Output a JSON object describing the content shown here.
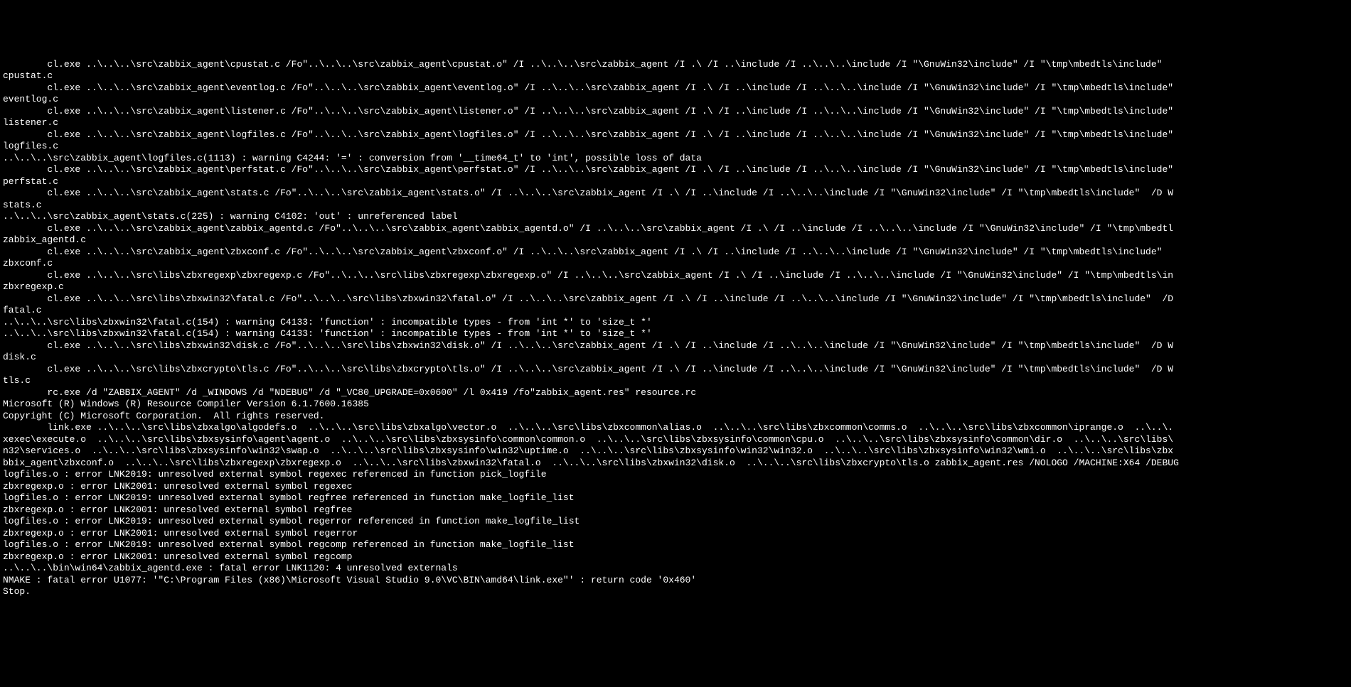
{
  "terminal": {
    "lines": [
      "        cl.exe ..\\..\\..\\src\\zabbix_agent\\cpustat.c /Fo\"..\\..\\..\\src\\zabbix_agent\\cpustat.o\" /I ..\\..\\..\\src\\zabbix_agent /I .\\ /I ..\\include /I ..\\..\\..\\include /I \"\\GnuWin32\\include\" /I \"\\tmp\\mbedtls\\include\"",
      "cpustat.c",
      "        cl.exe ..\\..\\..\\src\\zabbix_agent\\eventlog.c /Fo\"..\\..\\..\\src\\zabbix_agent\\eventlog.o\" /I ..\\..\\..\\src\\zabbix_agent /I .\\ /I ..\\include /I ..\\..\\..\\include /I \"\\GnuWin32\\include\" /I \"\\tmp\\mbedtls\\include\"",
      "eventlog.c",
      "        cl.exe ..\\..\\..\\src\\zabbix_agent\\listener.c /Fo\"..\\..\\..\\src\\zabbix_agent\\listener.o\" /I ..\\..\\..\\src\\zabbix_agent /I .\\ /I ..\\include /I ..\\..\\..\\include /I \"\\GnuWin32\\include\" /I \"\\tmp\\mbedtls\\include\"",
      "listener.c",
      "        cl.exe ..\\..\\..\\src\\zabbix_agent\\logfiles.c /Fo\"..\\..\\..\\src\\zabbix_agent\\logfiles.o\" /I ..\\..\\..\\src\\zabbix_agent /I .\\ /I ..\\include /I ..\\..\\..\\include /I \"\\GnuWin32\\include\" /I \"\\tmp\\mbedtls\\include\"",
      "logfiles.c",
      "..\\..\\..\\src\\zabbix_agent\\logfiles.c(1113) : warning C4244: '=' : conversion from '__time64_t' to 'int', possible loss of data",
      "        cl.exe ..\\..\\..\\src\\zabbix_agent\\perfstat.c /Fo\"..\\..\\..\\src\\zabbix_agent\\perfstat.o\" /I ..\\..\\..\\src\\zabbix_agent /I .\\ /I ..\\include /I ..\\..\\..\\include /I \"\\GnuWin32\\include\" /I \"\\tmp\\mbedtls\\include\"",
      "perfstat.c",
      "        cl.exe ..\\..\\..\\src\\zabbix_agent\\stats.c /Fo\"..\\..\\..\\src\\zabbix_agent\\stats.o\" /I ..\\..\\..\\src\\zabbix_agent /I .\\ /I ..\\include /I ..\\..\\..\\include /I \"\\GnuWin32\\include\" /I \"\\tmp\\mbedtls\\include\"  /D W",
      "stats.c",
      "..\\..\\..\\src\\zabbix_agent\\stats.c(225) : warning C4102: 'out' : unreferenced label",
      "        cl.exe ..\\..\\..\\src\\zabbix_agent\\zabbix_agentd.c /Fo\"..\\..\\..\\src\\zabbix_agent\\zabbix_agentd.o\" /I ..\\..\\..\\src\\zabbix_agent /I .\\ /I ..\\include /I ..\\..\\..\\include /I \"\\GnuWin32\\include\" /I \"\\tmp\\mbedtl",
      "zabbix_agentd.c",
      "        cl.exe ..\\..\\..\\src\\zabbix_agent\\zbxconf.c /Fo\"..\\..\\..\\src\\zabbix_agent\\zbxconf.o\" /I ..\\..\\..\\src\\zabbix_agent /I .\\ /I ..\\include /I ..\\..\\..\\include /I \"\\GnuWin32\\include\" /I \"\\tmp\\mbedtls\\include\"",
      "zbxconf.c",
      "        cl.exe ..\\..\\..\\src\\libs\\zbxregexp\\zbxregexp.c /Fo\"..\\..\\..\\src\\libs\\zbxregexp\\zbxregexp.o\" /I ..\\..\\..\\src\\zabbix_agent /I .\\ /I ..\\include /I ..\\..\\..\\include /I \"\\GnuWin32\\include\" /I \"\\tmp\\mbedtls\\in",
      "zbxregexp.c",
      "        cl.exe ..\\..\\..\\src\\libs\\zbxwin32\\fatal.c /Fo\"..\\..\\..\\src\\libs\\zbxwin32\\fatal.o\" /I ..\\..\\..\\src\\zabbix_agent /I .\\ /I ..\\include /I ..\\..\\..\\include /I \"\\GnuWin32\\include\" /I \"\\tmp\\mbedtls\\include\"  /D",
      "fatal.c",
      "..\\..\\..\\src\\libs\\zbxwin32\\fatal.c(154) : warning C4133: 'function' : incompatible types - from 'int *' to 'size_t *'",
      "..\\..\\..\\src\\libs\\zbxwin32\\fatal.c(154) : warning C4133: 'function' : incompatible types - from 'int *' to 'size_t *'",
      "        cl.exe ..\\..\\..\\src\\libs\\zbxwin32\\disk.c /Fo\"..\\..\\..\\src\\libs\\zbxwin32\\disk.o\" /I ..\\..\\..\\src\\zabbix_agent /I .\\ /I ..\\include /I ..\\..\\..\\include /I \"\\GnuWin32\\include\" /I \"\\tmp\\mbedtls\\include\"  /D W",
      "disk.c",
      "        cl.exe ..\\..\\..\\src\\libs\\zbxcrypto\\tls.c /Fo\"..\\..\\..\\src\\libs\\zbxcrypto\\tls.o\" /I ..\\..\\..\\src\\zabbix_agent /I .\\ /I ..\\include /I ..\\..\\..\\include /I \"\\GnuWin32\\include\" /I \"\\tmp\\mbedtls\\include\"  /D W",
      "tls.c",
      "        rc.exe /d \"ZABBIX_AGENT\" /d _WINDOWS /d \"NDEBUG\" /d \"_VC80_UPGRADE=0x0600\" /l 0x419 /fo\"zabbix_agent.res\" resource.rc",
      "Microsoft (R) Windows (R) Resource Compiler Version 6.1.7600.16385",
      "Copyright (C) Microsoft Corporation.  All rights reserved.",
      "",
      "",
      "        link.exe ..\\..\\..\\src\\libs\\zbxalgo\\algodefs.o  ..\\..\\..\\src\\libs\\zbxalgo\\vector.o  ..\\..\\..\\src\\libs\\zbxcommon\\alias.o  ..\\..\\..\\src\\libs\\zbxcommon\\comms.o  ..\\..\\..\\src\\libs\\zbxcommon\\iprange.o  ..\\..\\.",
      "xexec\\execute.o  ..\\..\\..\\src\\libs\\zbxsysinfo\\agent\\agent.o  ..\\..\\..\\src\\libs\\zbxsysinfo\\common\\common.o  ..\\..\\..\\src\\libs\\zbxsysinfo\\common\\cpu.o  ..\\..\\..\\src\\libs\\zbxsysinfo\\common\\dir.o  ..\\..\\..\\src\\libs\\",
      "n32\\services.o  ..\\..\\..\\src\\libs\\zbxsysinfo\\win32\\swap.o  ..\\..\\..\\src\\libs\\zbxsysinfo\\win32\\uptime.o  ..\\..\\..\\src\\libs\\zbxsysinfo\\win32\\win32.o  ..\\..\\..\\src\\libs\\zbxsysinfo\\win32\\wmi.o  ..\\..\\..\\src\\libs\\zbx",
      "bbix_agent\\zbxconf.o  ..\\..\\..\\src\\libs\\zbxregexp\\zbxregexp.o  ..\\..\\..\\src\\libs\\zbxwin32\\fatal.o  ..\\..\\..\\src\\libs\\zbxwin32\\disk.o  ..\\..\\..\\src\\libs\\zbxcrypto\\tls.o zabbix_agent.res /NOLOGO /MACHINE:X64 /DEBUG",
      "logfiles.o : error LNK2019: unresolved external symbol regexec referenced in function pick_logfile",
      "zbxregexp.o : error LNK2001: unresolved external symbol regexec",
      "logfiles.o : error LNK2019: unresolved external symbol regfree referenced in function make_logfile_list",
      "zbxregexp.o : error LNK2001: unresolved external symbol regfree",
      "logfiles.o : error LNK2019: unresolved external symbol regerror referenced in function make_logfile_list",
      "zbxregexp.o : error LNK2001: unresolved external symbol regerror",
      "logfiles.o : error LNK2019: unresolved external symbol regcomp referenced in function make_logfile_list",
      "zbxregexp.o : error LNK2001: unresolved external symbol regcomp",
      "..\\..\\..\\bin\\win64\\zabbix_agentd.exe : fatal error LNK1120: 4 unresolved externals",
      "NMAKE : fatal error U1077: '\"C:\\Program Files (x86)\\Microsoft Visual Studio 9.0\\VC\\BIN\\amd64\\link.exe\"' : return code '0x460'",
      "Stop."
    ]
  }
}
